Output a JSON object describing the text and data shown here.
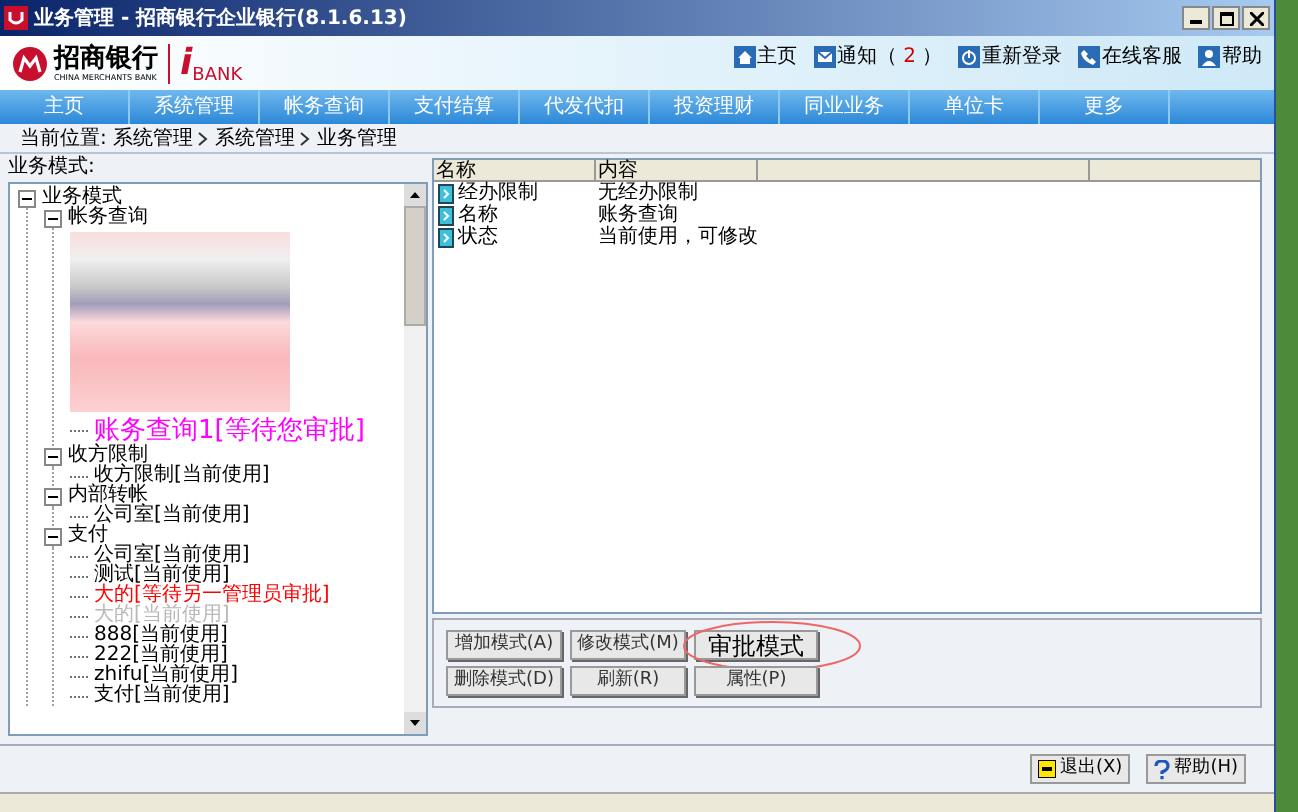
{
  "window": {
    "title": "业务管理 - 招商银行企业银行(8.1.6.13)"
  },
  "logo": {
    "name": "招商银行",
    "subtitle": "CHINA MERCHANTS BANK",
    "brand_i": "i",
    "brand": "BANK"
  },
  "top_links": [
    {
      "kind": "home",
      "label": "主页"
    },
    {
      "kind": "notice",
      "label": "通知（",
      "count": "2",
      "tail": "）"
    },
    {
      "kind": "relogin",
      "label": "重新登录"
    },
    {
      "kind": "service",
      "label": "在线客服"
    },
    {
      "kind": "help",
      "label": "帮助"
    }
  ],
  "nav": [
    "主页",
    "系统管理",
    "帐务查询",
    "支付结算",
    "代发代扣",
    "投资理财",
    "同业业务",
    "单位卡",
    "更多"
  ],
  "breadcrumb": {
    "label": "当前位置:",
    "path": [
      "系统管理",
      "系统管理",
      "业务管理"
    ]
  },
  "tree": {
    "label": "业务模式:",
    "items": [
      {
        "label": "业务模式",
        "expanded": true,
        "kind": "normal",
        "children": [
          {
            "label": "帐务查询",
            "expanded": true,
            "kind": "normal",
            "redacted": true,
            "children": [
              {
                "label": "账务查询1[等待您审批]",
                "kind": "awaiting_you"
              }
            ]
          },
          {
            "label": "收方限制",
            "expanded": true,
            "kind": "normal",
            "children": [
              {
                "label": "收方限制[当前使用]",
                "kind": "normal"
              }
            ]
          },
          {
            "label": "内部转帐",
            "expanded": true,
            "kind": "normal",
            "children": [
              {
                "label": "公司室[当前使用]",
                "kind": "normal"
              }
            ]
          },
          {
            "label": "支付",
            "expanded": true,
            "kind": "normal",
            "children": [
              {
                "label": "公司室[当前使用]",
                "kind": "normal"
              },
              {
                "label": "测试[当前使用]",
                "kind": "normal"
              },
              {
                "label": "大的[等待另一管理员审批]",
                "kind": "awaiting_other"
              },
              {
                "label": "大的[当前使用]",
                "kind": "inactive"
              },
              {
                "label": "888[当前使用]",
                "kind": "normal"
              },
              {
                "label": "222[当前使用]",
                "kind": "normal"
              },
              {
                "label": "zhifu[当前使用]",
                "kind": "normal"
              },
              {
                "label": "支付[当前使用]",
                "kind": "normal"
              }
            ]
          }
        ]
      }
    ]
  },
  "details": {
    "columns": [
      "名称",
      "内容"
    ],
    "rows": [
      {
        "name": "经办限制",
        "value": "无经办限制"
      },
      {
        "name": "名称",
        "value": "账务查询"
      },
      {
        "name": "状态",
        "value": "当前使用，可修改"
      }
    ]
  },
  "actions": [
    {
      "label": "增加模式(A)",
      "highlighted": false
    },
    {
      "label": "修改模式(M)",
      "highlighted": false
    },
    {
      "label": "审批模式",
      "highlighted": true
    },
    {
      "label": "删除模式(D)",
      "highlighted": false
    },
    {
      "label": "刷新(R)",
      "highlighted": false
    },
    {
      "label": "属性(P)",
      "highlighted": false
    }
  ],
  "footer_buttons": [
    {
      "kind": "exit",
      "label": "退出(X)"
    },
    {
      "kind": "help",
      "label": "帮助(H)"
    }
  ]
}
